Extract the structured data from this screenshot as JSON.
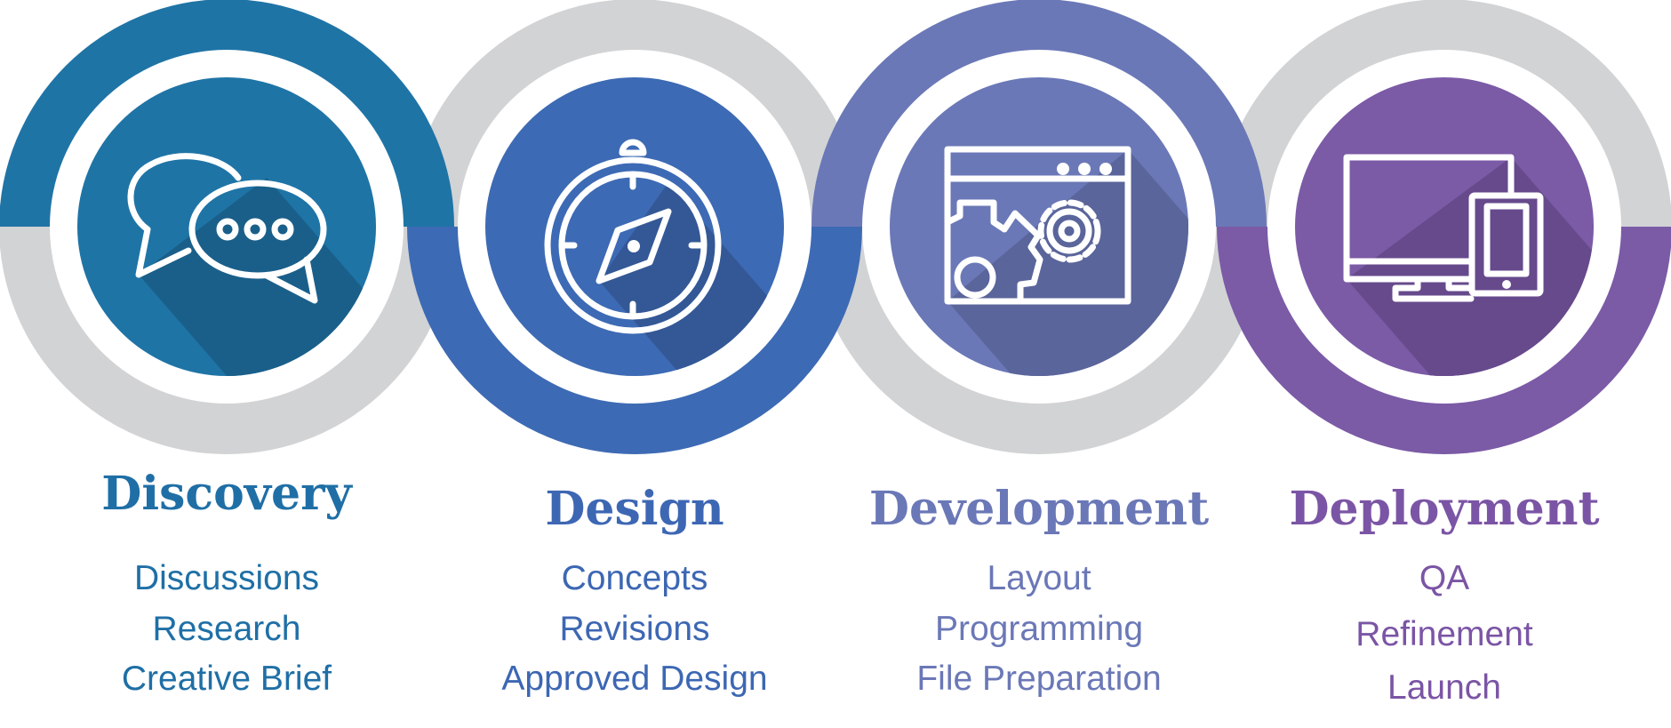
{
  "colors": {
    "ring_gray": "#d2d3d5",
    "white": "#ffffff"
  },
  "stages": [
    {
      "title": "Discovery",
      "icon": "chat-bubbles-icon",
      "color": "#1f74a6",
      "shadow": "#1a5f8a",
      "text_color": "#1f6fa6",
      "ring_color_half": "top",
      "items": [
        "Discussions",
        "Research",
        "Creative Brief"
      ]
    },
    {
      "title": "Design",
      "icon": "compass-icon",
      "color": "#3d6ab4",
      "shadow": "#345896",
      "text_color": "#3d67b3",
      "ring_color_half": "bottom",
      "items": [
        "Concepts",
        "Revisions",
        "Approved Design"
      ]
    },
    {
      "title": "Development",
      "icon": "browser-gears-icon",
      "color": "#6b78b7",
      "shadow": "#5a659b",
      "text_color": "#6b78b7",
      "ring_color_half": "top",
      "items": [
        "Layout",
        "Programming",
        "File Preparation"
      ]
    },
    {
      "title": "Deployment",
      "icon": "monitor-tablet-icon",
      "color": "#7b5aa6",
      "shadow": "#664a8c",
      "text_color": "#7b55a5",
      "ring_color_half": "bottom",
      "items": [
        "QA",
        "Refinement",
        "Launch"
      ]
    }
  ]
}
